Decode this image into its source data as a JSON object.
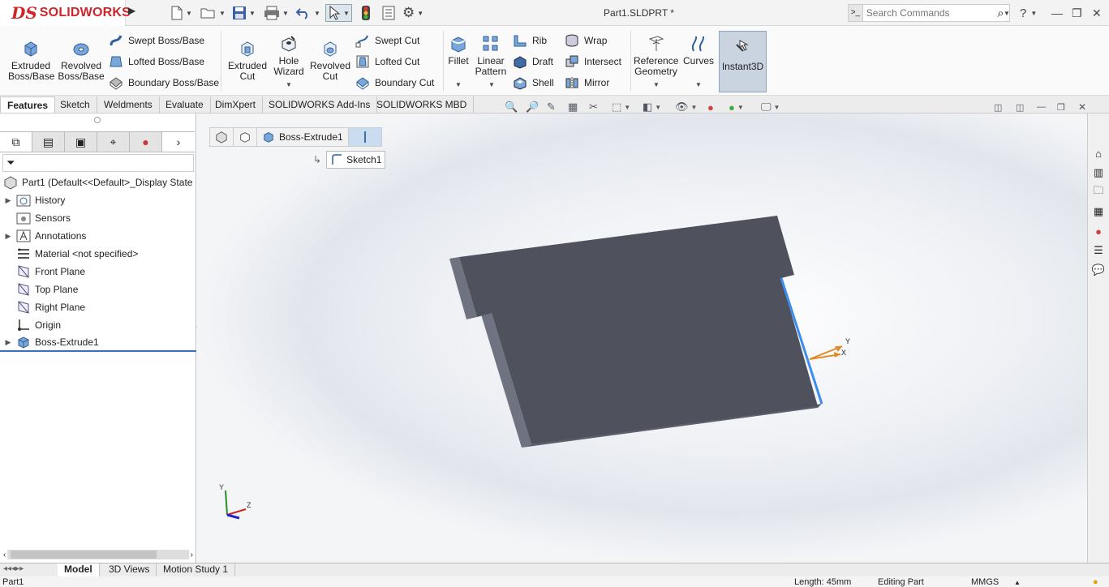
{
  "window": {
    "brand": "SOLIDWORKS",
    "brand_mark": "DS",
    "document_title": "Part1.SLDPRT *",
    "search_placeholder": "Search Commands",
    "help_label": "?"
  },
  "ribbon": {
    "extruded_boss": "Extruded Boss/Base",
    "revolved_boss": "Revolved Boss/Base",
    "swept_boss": "Swept Boss/Base",
    "lofted_boss": "Lofted Boss/Base",
    "boundary_boss": "Boundary Boss/Base",
    "extruded_cut": "Extruded Cut",
    "hole_wizard": "Hole Wizard",
    "revolved_cut": "Revolved Cut",
    "swept_cut": "Swept Cut",
    "lofted_cut": "Lofted Cut",
    "boundary_cut": "Boundary Cut",
    "fillet": "Fillet",
    "linear_pattern": "Linear Pattern",
    "rib": "Rib",
    "draft": "Draft",
    "shell": "Shell",
    "wrap": "Wrap",
    "intersect": "Intersect",
    "mirror": "Mirror",
    "reference_geometry": "Reference Geometry",
    "curves": "Curves",
    "instant3d": "Instant3D"
  },
  "command_tabs": [
    "Features",
    "Sketch",
    "Weldments",
    "Evaluate",
    "DimXpert",
    "SOLIDWORKS Add-Ins",
    "SOLIDWORKS MBD"
  ],
  "tree": {
    "root": "Part1  (Default<<Default>_Display State",
    "items": [
      "History",
      "Sensors",
      "Annotations",
      "Material <not specified>",
      "Front Plane",
      "Top Plane",
      "Right Plane",
      "Origin",
      "Boss-Extrude1"
    ]
  },
  "breadcrumb": {
    "feature": "Boss-Extrude1",
    "sketch": "Sketch1"
  },
  "triad": {
    "x": "X",
    "y": "Y",
    "z": "Z"
  },
  "bottom_tabs": [
    "Model",
    "3D Views",
    "Motion Study 1"
  ],
  "status": {
    "part": "Part1",
    "length": "Length: 45mm",
    "mode": "Editing Part",
    "units": "MMGS"
  },
  "colors": {
    "part_face": "#4f525c",
    "part_side": "#6f7280",
    "edge_highlight": "#3d8cf0",
    "brand_red": "#d1242a"
  }
}
